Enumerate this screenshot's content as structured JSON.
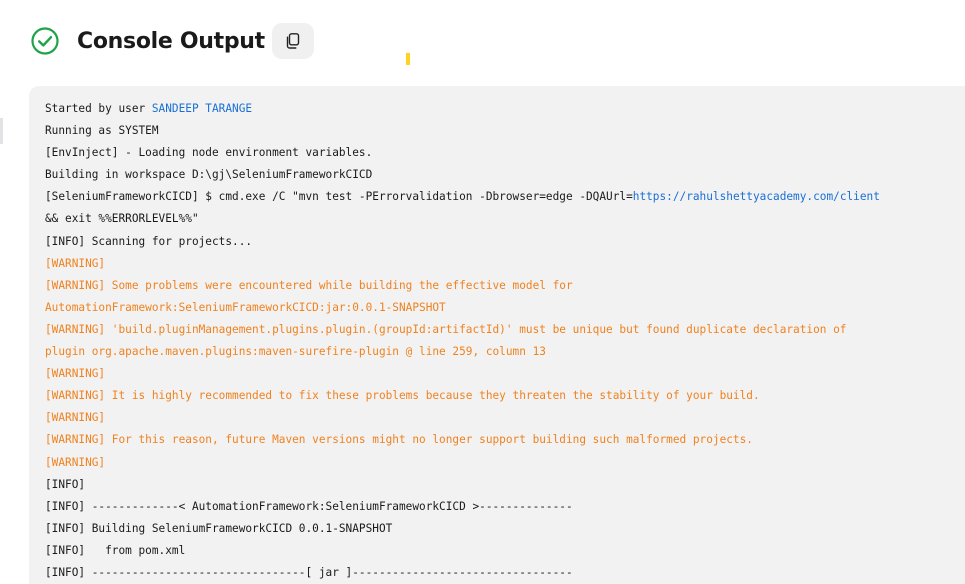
{
  "header": {
    "title": "Console Output",
    "status_icon": "check-circle-icon",
    "copy_icon": "copy-icon",
    "accent_color": "#1ea446"
  },
  "console": {
    "lines": [
      {
        "type": "info",
        "segments": [
          {
            "text": "Started by user "
          },
          {
            "text": "SANDEEP TARANGE",
            "link": true
          }
        ]
      },
      {
        "type": "info",
        "segments": [
          {
            "text": "Running as SYSTEM"
          }
        ]
      },
      {
        "type": "info",
        "segments": [
          {
            "text": "[EnvInject] - Loading node environment variables."
          }
        ]
      },
      {
        "type": "info",
        "segments": [
          {
            "text": "Building in workspace D:\\gj\\SeleniumFrameworkCICD"
          }
        ]
      },
      {
        "type": "info",
        "segments": [
          {
            "text": "[SeleniumFrameworkCICD] $ cmd.exe /C \"mvn test -PErrorvalidation -Dbrowser=edge -DQAUrl="
          },
          {
            "text": "https://rahulshettyacademy.com/client",
            "link": true
          }
        ]
      },
      {
        "type": "info",
        "segments": [
          {
            "text": "&& exit %%ERRORLEVEL%%\""
          }
        ]
      },
      {
        "type": "info",
        "segments": [
          {
            "text": "[INFO] Scanning for projects..."
          }
        ]
      },
      {
        "type": "warning",
        "segments": [
          {
            "text": "[WARNING]"
          }
        ]
      },
      {
        "type": "warning",
        "segments": [
          {
            "text": "[WARNING] Some problems were encountered while building the effective model for"
          }
        ]
      },
      {
        "type": "warning",
        "segments": [
          {
            "text": "AutomationFramework:SeleniumFrameworkCICD:jar:0.0.1-SNAPSHOT"
          }
        ]
      },
      {
        "type": "warning",
        "segments": [
          {
            "text": "[WARNING] 'build.pluginManagement.plugins.plugin.(groupId:artifactId)' must be unique but found duplicate declaration of"
          }
        ]
      },
      {
        "type": "warning",
        "segments": [
          {
            "text": "plugin org.apache.maven.plugins:maven-surefire-plugin @ line 259, column 13"
          }
        ]
      },
      {
        "type": "warning",
        "segments": [
          {
            "text": "[WARNING]"
          }
        ]
      },
      {
        "type": "warning",
        "segments": [
          {
            "text": "[WARNING] It is highly recommended to fix these problems because they threaten the stability of your build."
          }
        ]
      },
      {
        "type": "warning",
        "segments": [
          {
            "text": "[WARNING]"
          }
        ]
      },
      {
        "type": "warning",
        "segments": [
          {
            "text": "[WARNING] For this reason, future Maven versions might no longer support building such malformed projects."
          }
        ]
      },
      {
        "type": "warning",
        "segments": [
          {
            "text": "[WARNING]"
          }
        ]
      },
      {
        "type": "info",
        "segments": [
          {
            "text": "[INFO]"
          }
        ]
      },
      {
        "type": "info",
        "segments": [
          {
            "text": "[INFO] -------------< AutomationFramework:SeleniumFrameworkCICD >--------------"
          }
        ]
      },
      {
        "type": "info",
        "segments": [
          {
            "text": "[INFO] Building SeleniumFrameworkCICD 0.0.1-SNAPSHOT"
          }
        ]
      },
      {
        "type": "info",
        "segments": [
          {
            "text": "[INFO]   from pom.xml"
          }
        ]
      },
      {
        "type": "info",
        "segments": [
          {
            "text": "[INFO] --------------------------------[ jar ]---------------------------------"
          }
        ]
      }
    ]
  }
}
